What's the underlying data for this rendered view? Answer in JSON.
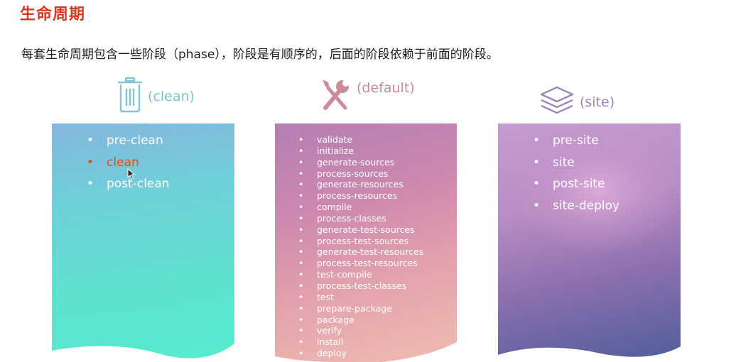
{
  "page": {
    "title": "生命周期",
    "subtitle": "每套生命周期包含一些阶段（phase），阶段是有顺序的，后面的阶段依赖于前面的阶段。"
  },
  "lifecycles": {
    "clean": {
      "label": "(clean)",
      "icon": "trash-icon",
      "color": "#7dc3cf",
      "phases": [
        "pre-clean",
        "clean",
        "post-clean"
      ],
      "highlighted_phase": "clean",
      "highlight_color": "#e24a15"
    },
    "default": {
      "label": "(default)",
      "icon": "wrench-screwdriver-icon",
      "color": "#c98a9c",
      "phases": [
        "validate",
        "initialize",
        "generate-sources",
        "process-sources",
        "generate-resources",
        "process-resources",
        "compile",
        "process-classes",
        "generate-test-sources",
        "process-test-sources",
        "generate-test-resources",
        "process-test-resources",
        "test-compile",
        "process-test-classes",
        "test",
        "prepare-package",
        "package",
        "verify",
        "install",
        "deploy"
      ]
    },
    "site": {
      "label": "(site)",
      "icon": "layers-icon",
      "color": "#9a86b6",
      "phases": [
        "pre-site",
        "site",
        "post-site",
        "site-deploy"
      ]
    }
  }
}
